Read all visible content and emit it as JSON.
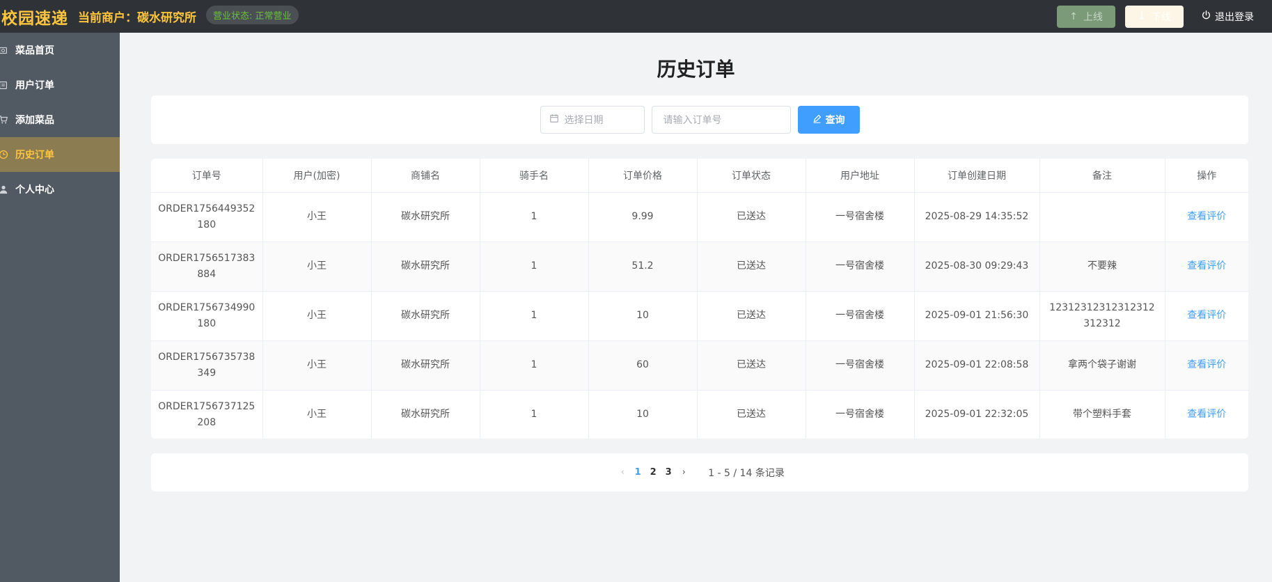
{
  "header": {
    "logo": "校园速递",
    "merchant": "当前商户：碳水研究所",
    "status": "营业状态: 正常营业",
    "online_label": "上线",
    "offline_label": "下线",
    "logout_label": "退出登录"
  },
  "sidebar": {
    "items": [
      {
        "label": "菜品首页",
        "icon": "dish-icon"
      },
      {
        "label": "用户订单",
        "icon": "list-icon"
      },
      {
        "label": "添加菜品",
        "icon": "cart-icon"
      },
      {
        "label": "历史订单",
        "icon": "clock-icon",
        "active": true
      },
      {
        "label": "个人中心",
        "icon": "user-icon"
      }
    ]
  },
  "main": {
    "title": "历史订单",
    "search": {
      "date_placeholder": "选择日期",
      "order_placeholder": "请输入订单号",
      "query_label": "查询"
    },
    "table": {
      "columns": [
        "订单号",
        "用户(加密)",
        "商铺名",
        "骑手名",
        "订单价格",
        "订单状态",
        "用户地址",
        "订单创建日期",
        "备注",
        "操作"
      ],
      "rows": [
        [
          "ORDER1756449352180",
          "小王",
          "碳水研究所",
          "1",
          "9.99",
          "已送达",
          "一号宿舍楼",
          "2025-08-29 14:35:52",
          "",
          "查看评价"
        ],
        [
          "ORDER1756517383884",
          "小王",
          "碳水研究所",
          "1",
          "51.2",
          "已送达",
          "一号宿舍楼",
          "2025-08-30 09:29:43",
          "不要辣",
          "查看评价"
        ],
        [
          "ORDER1756734990180",
          "小王",
          "碳水研究所",
          "1",
          "10",
          "已送达",
          "一号宿舍楼",
          "2025-09-01 21:56:30",
          "12312312312312312312312",
          "查看评价"
        ],
        [
          "ORDER1756735738349",
          "小王",
          "碳水研究所",
          "1",
          "60",
          "已送达",
          "一号宿舍楼",
          "2025-09-01 22:08:58",
          "拿两个袋子谢谢",
          "查看评价"
        ],
        [
          "ORDER1756737125208",
          "小王",
          "碳水研究所",
          "1",
          "10",
          "已送达",
          "一号宿舍楼",
          "2025-09-01 22:32:05",
          "带个塑料手套",
          "查看评价"
        ]
      ]
    },
    "pagination": {
      "pages": [
        "1",
        "2",
        "3"
      ],
      "current": "1",
      "summary": "1 - 5 / 14 条记录"
    }
  },
  "colors": {
    "accent": "#ffc53d",
    "primary": "#409eff",
    "header_bg": "#2f3337",
    "sidebar_bg": "#515a63"
  }
}
